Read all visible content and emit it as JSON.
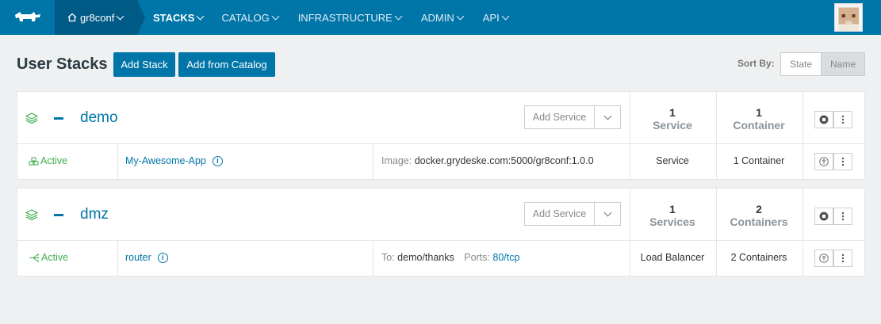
{
  "nav": {
    "environment": "gr8conf",
    "items": [
      {
        "label": "STACKS"
      },
      {
        "label": "CATALOG"
      },
      {
        "label": "INFRASTRUCTURE"
      },
      {
        "label": "ADMIN"
      },
      {
        "label": "API"
      }
    ],
    "accent": "#0075a8"
  },
  "header": {
    "title": "User Stacks",
    "add_stack": "Add Stack",
    "add_from_catalog": "Add from Catalog",
    "sort_by_label": "Sort By:",
    "sort_options": [
      "State",
      "Name"
    ],
    "sort_selected": "Name"
  },
  "stacks": [
    {
      "name": "demo",
      "add_service": "Add Service",
      "service_count": "1",
      "service_unit": "Service",
      "container_count": "1",
      "container_unit": "Container",
      "services": [
        {
          "state": "Active",
          "name": "My-Awesome-App",
          "detail_label": "Image:",
          "detail_value": "docker.grydeske.com:5000/gr8conf:1.0.0",
          "kind": "Service",
          "containers": "1 Container"
        }
      ]
    },
    {
      "name": "dmz",
      "add_service": "Add Service",
      "service_count": "1",
      "service_unit": "Services",
      "container_count": "2",
      "container_unit": "Containers",
      "services": [
        {
          "state": "Active",
          "name": "router",
          "detail_label": "To:",
          "detail_value": "demo/thanks",
          "ports_label": "Ports:",
          "ports_value": "80/tcp",
          "kind": "Load Balancer",
          "containers": "2 Containers"
        }
      ]
    }
  ]
}
